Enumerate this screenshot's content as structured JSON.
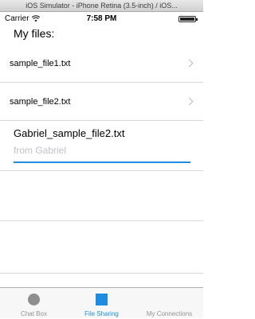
{
  "window": {
    "title": "iOS Simulator - iPhone Retina (3.5-inch) / iOS..."
  },
  "status_bar": {
    "carrier": "Carrier",
    "time": "7:58 PM"
  },
  "page": {
    "title": "My files:"
  },
  "files": [
    {
      "name": "sample_file1.txt"
    },
    {
      "name": "sample_file2.txt"
    }
  ],
  "incoming": {
    "name": "Gabriel_sample_file2.txt",
    "subtitle": "from Gabriel",
    "progress": 1.0
  },
  "tabs": [
    {
      "label": "Chat Box",
      "icon": "circle-icon",
      "active": false
    },
    {
      "label": "File Sharing",
      "icon": "square-icon",
      "active": true
    },
    {
      "label": "My Connections",
      "icon": "none",
      "active": false
    }
  ],
  "colors": {
    "accent": "#1e8de1",
    "inactive_icon": "#8e8e8e",
    "inactive_text": "#929292"
  }
}
